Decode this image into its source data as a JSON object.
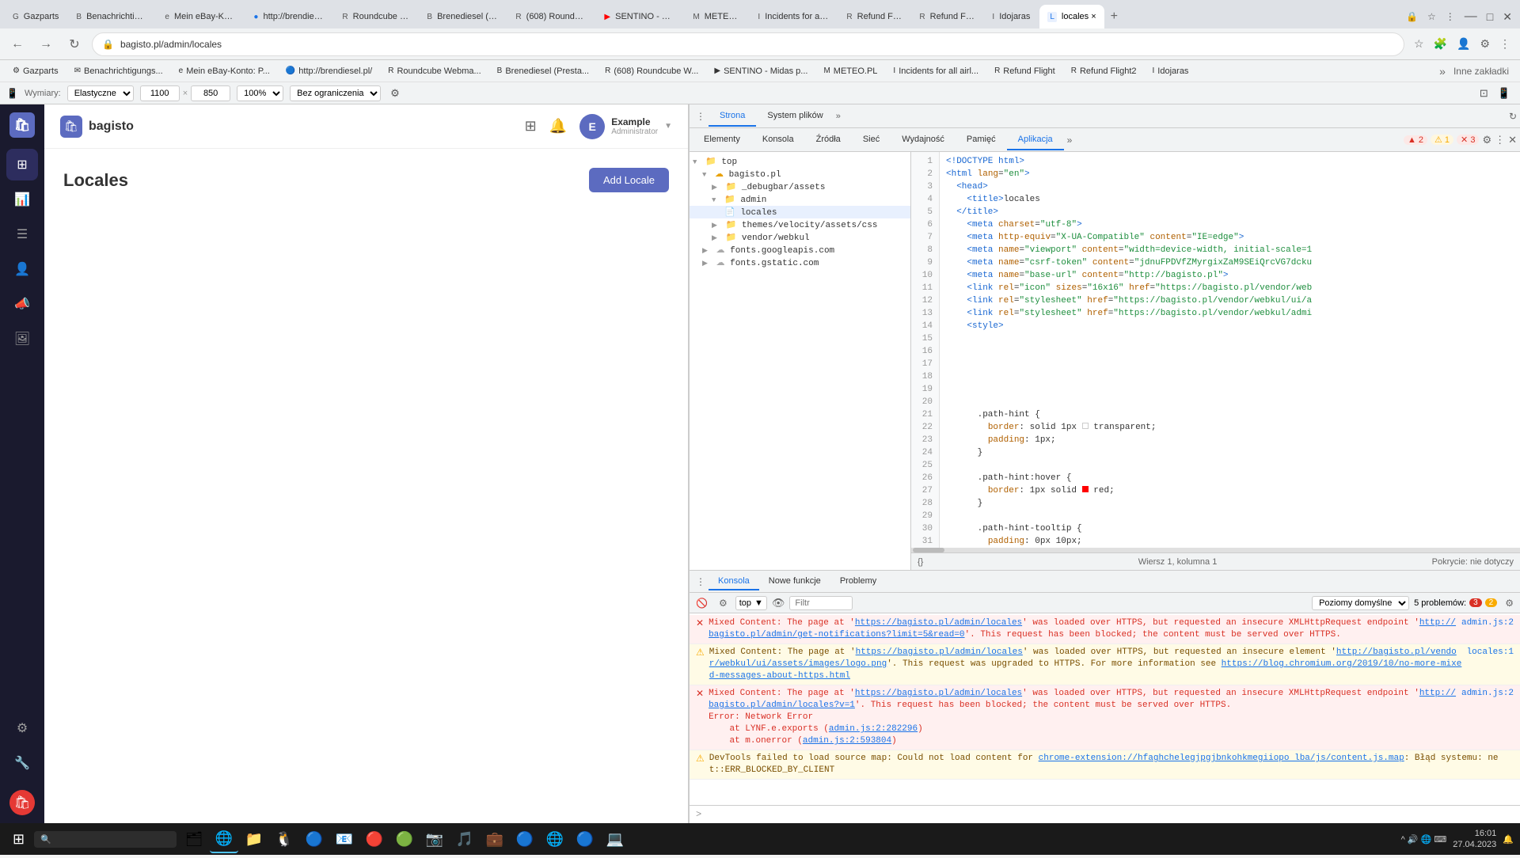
{
  "browser": {
    "tabs": [
      {
        "label": "Gazparts",
        "icon": "G",
        "active": false
      },
      {
        "label": "Benachrichtigungs...",
        "icon": "B",
        "active": false
      },
      {
        "label": "Mein eBay-Konto: P...",
        "icon": "e",
        "active": false
      },
      {
        "label": "http://brendiesel.pl/",
        "icon": "🔵",
        "active": false
      },
      {
        "label": "Roundcube Webma...",
        "icon": "R",
        "active": false
      },
      {
        "label": "Brenediesel (Presta...",
        "icon": "B",
        "active": false
      },
      {
        "label": "(608) Roundcube W...",
        "icon": "R",
        "active": false
      },
      {
        "label": "SENTINO - Midas p...",
        "icon": "▶",
        "active": false
      },
      {
        "label": "METEO.PL",
        "icon": "M",
        "active": false
      },
      {
        "label": "Incidents for all air...",
        "icon": "I",
        "active": false
      },
      {
        "label": "Refund Flight",
        "icon": "R",
        "active": false
      },
      {
        "label": "Refund Flight2",
        "icon": "R",
        "active": false
      },
      {
        "label": "Idojaras",
        "icon": "I",
        "active": false
      },
      {
        "label": "locales ×",
        "icon": "L",
        "active": true
      }
    ],
    "address": "bagisto.pl/admin/locales",
    "devtools_tabs": [
      "Strona",
      "System plików"
    ],
    "devtools_panel_tabs": [
      "Elementy",
      "Konsola",
      "Źródła",
      "Sieć",
      "Wydajność",
      "Pamięć",
      "Aplikacja"
    ],
    "responsive_bar": {
      "device": "Elastyczne",
      "width": "1100",
      "height": "850",
      "zoom": "100%",
      "limit": "Bez ograniczenia"
    }
  },
  "bookmarks": [
    "Gazparts",
    "Benachrichtigungs...",
    "Mein eBay-Konto: P...",
    "http://brendiesel.pl/",
    "Roundcube Webma...",
    "Brenediesel (Presta...",
    "(608) Roundcube W...",
    "SENTINO - Midas p...",
    "METEO.PL",
    "Incidents for all airl...",
    "Refund Flight",
    "Refund Flight2",
    "Idojaras"
  ],
  "bagisto": {
    "brand": "bagisto",
    "page_title": "Locales",
    "add_button": "Add Locale",
    "user": {
      "name": "Example",
      "role": "Administrator",
      "initial": "E"
    },
    "sidebar_items": [
      {
        "icon": "⊞",
        "name": "dashboard"
      },
      {
        "icon": "📊",
        "name": "reports"
      },
      {
        "icon": "☰",
        "name": "catalog"
      },
      {
        "icon": "👤",
        "name": "customers"
      },
      {
        "icon": "📣",
        "name": "marketing"
      },
      {
        "icon": "🖼",
        "name": "content"
      }
    ],
    "sidebar_bottom": [
      {
        "icon": "⚙",
        "name": "settings"
      },
      {
        "icon": "🔧",
        "name": "tools"
      }
    ]
  },
  "source_tree": {
    "items": [
      {
        "label": "top",
        "indent": 0,
        "type": "folder",
        "expanded": true
      },
      {
        "label": "bagisto.pl",
        "indent": 1,
        "type": "folder",
        "expanded": true
      },
      {
        "label": "_debugbar/assets",
        "indent": 2,
        "type": "folder",
        "expanded": false
      },
      {
        "label": "admin",
        "indent": 2,
        "type": "folder",
        "expanded": true
      },
      {
        "label": "locales",
        "indent": 3,
        "type": "file",
        "selected": true
      },
      {
        "label": "themes/velocity/assets/css",
        "indent": 2,
        "type": "folder",
        "expanded": false
      },
      {
        "label": "vendor/webkul",
        "indent": 2,
        "type": "folder",
        "expanded": false
      },
      {
        "label": "fonts.googleapis.com",
        "indent": 1,
        "type": "folder",
        "expanded": false
      },
      {
        "label": "fonts.gstatic.com",
        "indent": 1,
        "type": "folder",
        "expanded": false
      }
    ]
  },
  "code_view": {
    "lines": [
      {
        "num": 1,
        "content": "<!DOCTYPE html>"
      },
      {
        "num": 2,
        "content": "<html lang=\"en\">"
      },
      {
        "num": 3,
        "content": "  <head>"
      },
      {
        "num": 4,
        "content": "    <title>locales"
      },
      {
        "num": 5,
        "content": "  </title>"
      },
      {
        "num": 6,
        "content": "    <meta charset=\"utf-8\">"
      },
      {
        "num": 7,
        "content": "    <meta http-equiv=\"X-UA-Compatible\" content=\"IE=edge\">"
      },
      {
        "num": 8,
        "content": "    <meta name=\"viewport\" content=\"width=device-width, initial-scale=1"
      },
      {
        "num": 9,
        "content": "    <meta name=\"csrf-token\" content=\"jdnuFPDVfZMyrgixZaM9SEiQrcVG7dcku"
      },
      {
        "num": 10,
        "content": "    <meta name=\"base-url\" content=\"http://bagisto.pl\">"
      },
      {
        "num": 11,
        "content": "    <link rel=\"icon\" sizes=\"16x16\" href=\"https://bagisto.pl/vendor/web"
      },
      {
        "num": 12,
        "content": "    <link rel=\"stylesheet\" href=\"https://bagisto.pl/vendor/webkul/ui/a"
      },
      {
        "num": 13,
        "content": "    <link rel=\"stylesheet\" href=\"https://bagisto.pl/vendor/webkul/admi"
      },
      {
        "num": 14,
        "content": "    <style>"
      },
      {
        "num": 15,
        "content": ""
      },
      {
        "num": 16,
        "content": ""
      },
      {
        "num": 17,
        "content": ""
      },
      {
        "num": 18,
        "content": ""
      },
      {
        "num": 19,
        "content": ""
      },
      {
        "num": 20,
        "content": ""
      },
      {
        "num": 21,
        "content": "      .path-hint {"
      },
      {
        "num": 22,
        "content": "        border: solid 1px  transparent;"
      },
      {
        "num": 23,
        "content": "        padding: 1px;"
      },
      {
        "num": 24,
        "content": "      }"
      },
      {
        "num": 25,
        "content": ""
      },
      {
        "num": 26,
        "content": "      .path-hint:hover {"
      },
      {
        "num": 27,
        "content": "        border: 1px solid  red;"
      },
      {
        "num": 28,
        "content": "      }"
      },
      {
        "num": 29,
        "content": ""
      },
      {
        "num": 30,
        "content": "      .path-hint-tooltip {"
      },
      {
        "num": 31,
        "content": "        padding: 0px 10px;"
      }
    ],
    "status": "Wiersz 1, kolumna 1",
    "coverage": "Pokrycie: nie dotyczy"
  },
  "console": {
    "tabs": [
      "Konsola",
      "Nowe funkcje",
      "Problemy"
    ],
    "active_tab": "Konsola",
    "toolbar": {
      "context": "top",
      "filter_placeholder": "Filtr",
      "levels": "Poziomy domyślne",
      "problems_label": "5 problemów:",
      "error_count": "3",
      "warning_count": "2"
    },
    "messages": [
      {
        "type": "error",
        "text": "Mixed Content: The page at 'https://bagisto.pl/admin/locales' was loaded over HTTPS, but requested an insecure XMLHttpRequest endpoint 'http://bagisto.pl/admin/get-notifications?limit=5&read=0'. This request has been blocked; the content must be served over HTTPS.",
        "source": "admin.js:2",
        "link": "https://bagisto.pl/admin/locales"
      },
      {
        "type": "warning",
        "text": "Mixed Content: The page at 'https://bagisto.pl/admin/locales' was loaded over HTTPS, but requested an insecure element 'http://bagisto.pl/vendor/webkul/ui/assets/images/logo.png'. This request was upgraded to HTTPS. For more information see https://blog.chromium.org/2019/10/no-more-mixed-messages-about-https.html",
        "source": "locales:1",
        "link": "https://bagisto.pl/admin/locales"
      },
      {
        "type": "error",
        "text": "Mixed Content: The page at 'https://bagisto.pl/admin/locales' was loaded over HTTPS, but requested an insecure XMLHttpRequest endpoint 'http://bagisto.pl/admin/locales?v=1'. This request has been blocked; the content must be served over HTTPS.\nError: Network Error\n    at LYNF.e.exports (admin.js:2:282296)\n    at m.onerror (admin.js:2:593804)",
        "source": "admin.js:2",
        "link": "https://bagisto.pl/admin/locales"
      },
      {
        "type": "warning",
        "text": "DevTools failed to load source map: Could not load content for chrome-extension://hfaghchelegjpgjbnkohkmegiiopo lba/js/content.js.map: Błąd systemu: net::ERR_BLOCKED_BY_CLIENT",
        "source": "",
        "link": ""
      }
    ]
  },
  "taskbar": {
    "time": "16:01",
    "date": "27.04.2023",
    "apps": [
      "⊞",
      "🔍",
      "🗂",
      "📁",
      "🌐",
      "📧",
      "🔵",
      "📷",
      "🎵",
      "🔵"
    ]
  }
}
